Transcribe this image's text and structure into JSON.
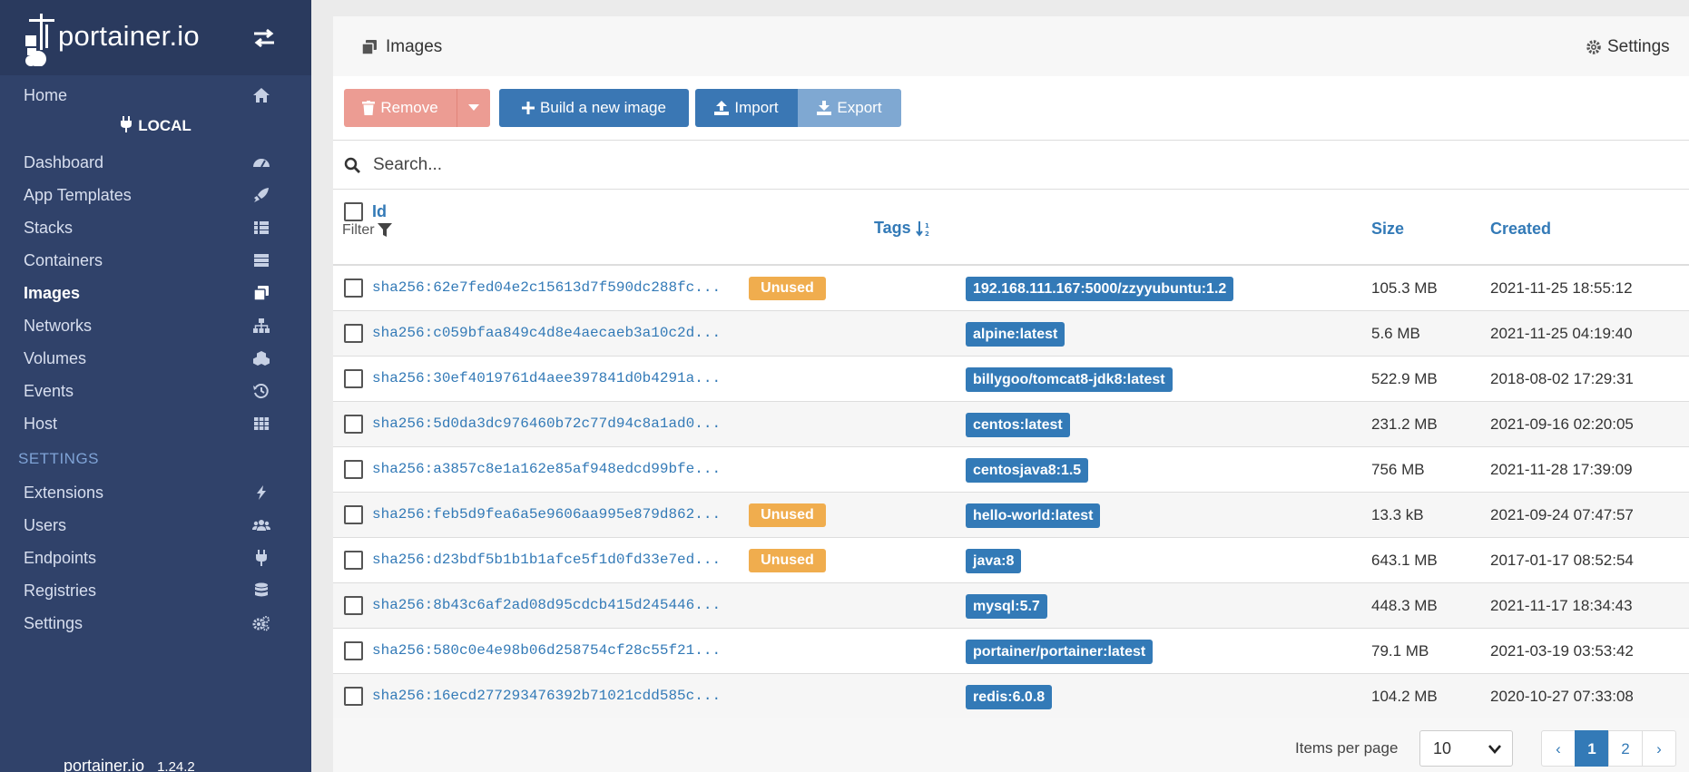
{
  "app": {
    "brand": "portainer.io",
    "version": "1.24.2"
  },
  "sidebar": {
    "home": "Home",
    "endpoint": "LOCAL",
    "items": [
      {
        "label": "Dashboard",
        "icon": "tachometer-icon"
      },
      {
        "label": "App Templates",
        "icon": "rocket-icon"
      },
      {
        "label": "Stacks",
        "icon": "th-list-icon"
      },
      {
        "label": "Containers",
        "icon": "server-icon"
      },
      {
        "label": "Images",
        "icon": "clone-icon",
        "active": true
      },
      {
        "label": "Networks",
        "icon": "sitemap-icon"
      },
      {
        "label": "Volumes",
        "icon": "cubes-icon"
      },
      {
        "label": "Events",
        "icon": "history-icon"
      },
      {
        "label": "Host",
        "icon": "th-icon"
      }
    ],
    "settings_heading": "SETTINGS",
    "settings_items": [
      {
        "label": "Extensions",
        "icon": "bolt-icon"
      },
      {
        "label": "Users",
        "icon": "users-icon"
      },
      {
        "label": "Endpoints",
        "icon": "plug-icon"
      },
      {
        "label": "Registries",
        "icon": "database-icon"
      },
      {
        "label": "Settings",
        "icon": "cogs-icon"
      }
    ]
  },
  "header": {
    "title": "Images",
    "settings": "Settings"
  },
  "toolbar": {
    "remove": "Remove",
    "build": "Build a new image",
    "import": "Import",
    "export": "Export"
  },
  "search": {
    "placeholder": "Search..."
  },
  "table": {
    "columns": {
      "id": "Id",
      "filter": "Filter",
      "tags": "Tags",
      "size": "Size",
      "created": "Created"
    },
    "unused_label": "Unused",
    "rows": [
      {
        "id": "sha256:62e7fed04e2c15613d7f590dc288fc...",
        "unused": true,
        "tag": "192.168.111.167:5000/zzyyubuntu:1.2",
        "size": "105.3 MB",
        "created": "2021-11-25 18:55:12"
      },
      {
        "id": "sha256:c059bfaa849c4d8e4aecaeb3a10c2d...",
        "unused": false,
        "tag": "alpine:latest",
        "size": "5.6 MB",
        "created": "2021-11-25 04:19:40"
      },
      {
        "id": "sha256:30ef4019761d4aee397841d0b4291a...",
        "unused": false,
        "tag": "billygoo/tomcat8-jdk8:latest",
        "size": "522.9 MB",
        "created": "2018-08-02 17:29:31"
      },
      {
        "id": "sha256:5d0da3dc976460b72c77d94c8a1ad0...",
        "unused": false,
        "tag": "centos:latest",
        "size": "231.2 MB",
        "created": "2021-09-16 02:20:05"
      },
      {
        "id": "sha256:a3857c8e1a162e85af948edcd99bfe...",
        "unused": false,
        "tag": "centosjava8:1.5",
        "size": "756 MB",
        "created": "2021-11-28 17:39:09"
      },
      {
        "id": "sha256:feb5d9fea6a5e9606aa995e879d862...",
        "unused": true,
        "tag": "hello-world:latest",
        "size": "13.3 kB",
        "created": "2021-09-24 07:47:57"
      },
      {
        "id": "sha256:d23bdf5b1b1b1afce5f1d0fd33e7ed...",
        "unused": true,
        "tag": "java:8",
        "size": "643.1 MB",
        "created": "2017-01-17 08:52:54"
      },
      {
        "id": "sha256:8b43c6af2ad08d95cdcb415d245446...",
        "unused": false,
        "tag": "mysql:5.7",
        "size": "448.3 MB",
        "created": "2021-11-17 18:34:43"
      },
      {
        "id": "sha256:580c0e4e98b06d258754cf28c55f21...",
        "unused": false,
        "tag": "portainer/portainer:latest",
        "size": "79.1 MB",
        "created": "2021-03-19 03:53:42"
      },
      {
        "id": "sha256:16ecd277293476392b71021cdd585c...",
        "unused": false,
        "tag": "redis:6.0.8",
        "size": "104.2 MB",
        "created": "2020-10-27 07:33:08"
      }
    ]
  },
  "pagination": {
    "items_per_page_label": "Items per page",
    "items_per_page": "10",
    "prev": "‹",
    "pages": [
      "1",
      "2"
    ],
    "current": "1",
    "next": "›"
  },
  "colors": {
    "sidebar": "#30426a",
    "primary": "#337ab7",
    "danger_light": "#ec9c93",
    "warning": "#f0ad4e"
  }
}
